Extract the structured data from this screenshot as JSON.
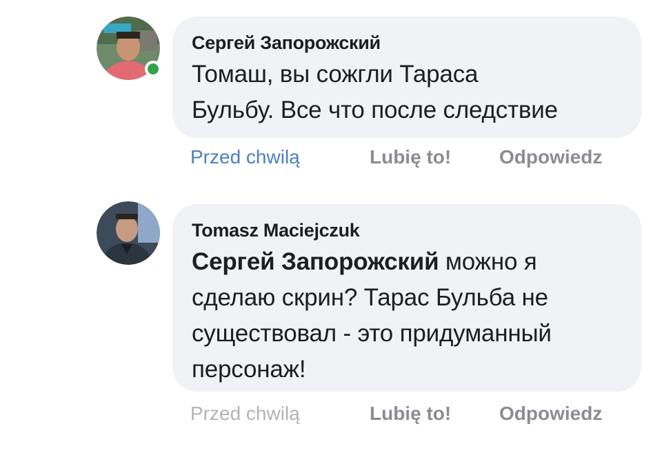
{
  "comments": [
    {
      "author": "Сергей Запорожский",
      "text_line_1": "Томаш, вы сожгли Тараса",
      "text_line_2": "Бульбу. Все что после следствие",
      "time": "Przed chwilą",
      "like": "Lubię to!",
      "reply": "Odpowiedz",
      "online": true
    },
    {
      "author": "Tomasz Maciejczuk",
      "mention": "Сергей Запорожский",
      "text_line_1_rest": " можно я",
      "text_line_2": "сделаю скрин? Тарас Бульба не",
      "text_line_3": "существовал - это придуманный",
      "text_line_4": "персонаж!",
      "time": "Przed chwilą",
      "like": "Lubię to!",
      "reply": "Odpowiedz",
      "online": false
    }
  ],
  "colors": {
    "bubble": "#f0f2f5",
    "text": "#1c1e21",
    "time_active": "#4a7fc1",
    "time_muted": "#b0b3b8",
    "action": "#8a8d91",
    "online": "#31a24c"
  }
}
